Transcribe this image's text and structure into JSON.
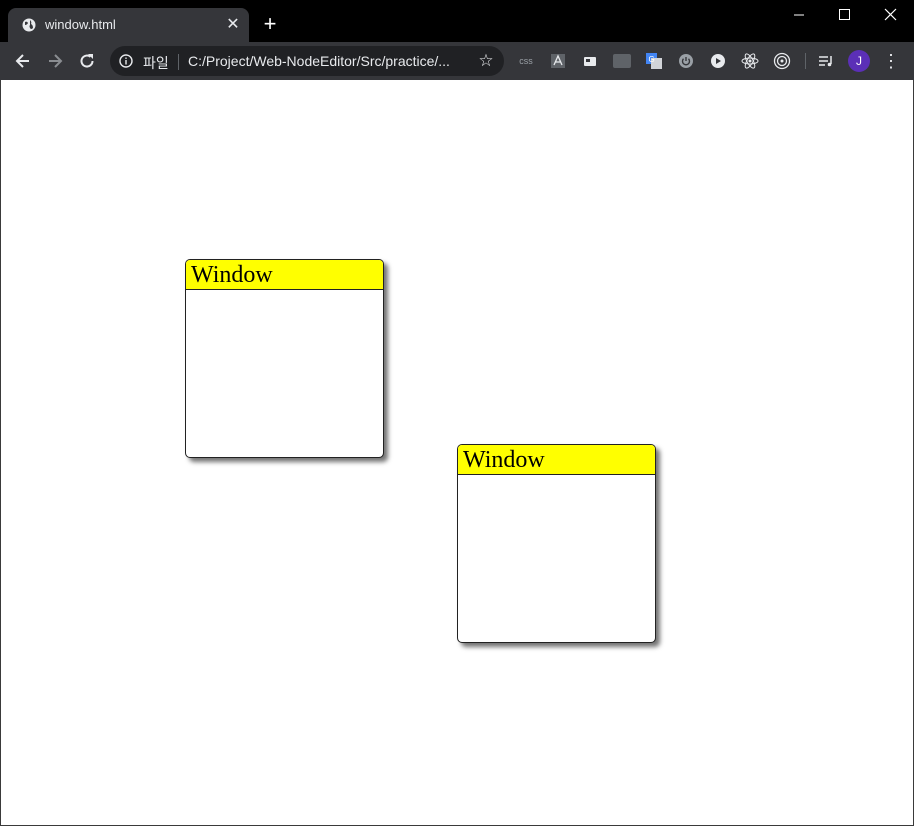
{
  "browser": {
    "tab": {
      "title": "window.html",
      "close_icon": "close-icon",
      "favicon": "globe-icon"
    },
    "new_tab_icon": "plus-icon",
    "window_controls": [
      "minimize-icon",
      "maximize-icon",
      "close-icon"
    ],
    "nav": [
      "back-arrow-icon",
      "forward-arrow-icon",
      "reload-icon"
    ],
    "address_bar": {
      "scheme_label": "파일",
      "url": "C:/Project/Web-NodeEditor/Src/practice/...",
      "bookmark_icon": "star-icon"
    },
    "extensions": [
      "css-extension-icon",
      "font-extension-icon",
      "card-extension-icon",
      "fx-extension-icon",
      "translate-extension-icon",
      "power-extension-icon",
      "play-extension-icon",
      "react-extension-icon",
      "target-extension-icon",
      "playlist-icon"
    ],
    "extension_labels": {
      "css": "css",
      "fx": "FX"
    },
    "profile": {
      "initial": "J",
      "color": "#5b2fb7"
    },
    "menu_icon": "more-vert-icon"
  },
  "page": {
    "windows": [
      {
        "title": "Window",
        "header_color": "#ffff00"
      },
      {
        "title": "Window",
        "header_color": "#ffff00"
      }
    ]
  }
}
